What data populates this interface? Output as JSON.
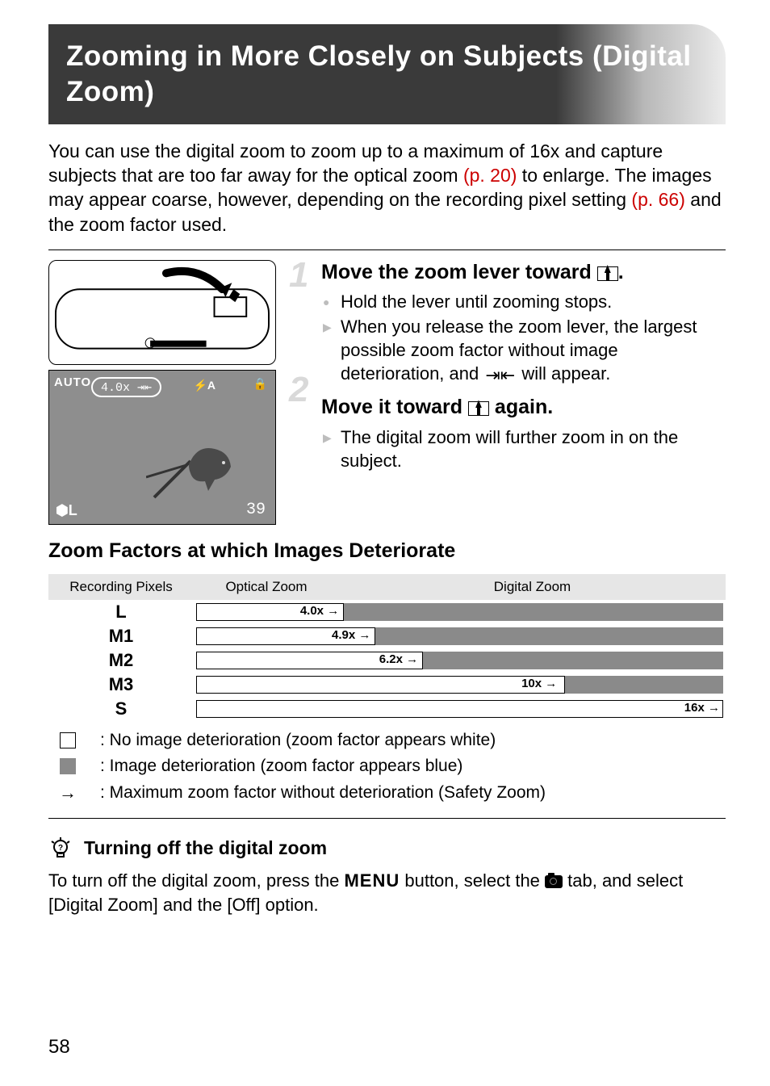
{
  "title": "Zooming in More Closely on Subjects (Digital Zoom)",
  "intro": {
    "part1": "You can use the digital zoom to zoom up to a maximum of 16x and capture subjects that are too far away for the optical zoom ",
    "ref1": "(p. 20)",
    "part2": " to enlarge. The images may appear coarse, however, depending on the recording pixel setting ",
    "ref2": "(p. 66)",
    "part3": " and the zoom factor used."
  },
  "steps": {
    "s1": {
      "num": "1",
      "heading_pre": "Move the zoom lever toward ",
      "heading_post": ".",
      "bullet1": "Hold the lever until zooming stops.",
      "bullet2_pre": "When you release the zoom lever, the largest possible zoom factor without image deterioration, and ",
      "bullet2_icon": "⇥⇤",
      "bullet2_post": " will appear."
    },
    "s2": {
      "num": "2",
      "heading_pre": "Move it toward ",
      "heading_post": " again.",
      "bullet1": "The digital zoom will further zoom in on the subject."
    }
  },
  "step_illus": {
    "lcd_zoom": "4.0x",
    "lcd_auto": "AUTO",
    "lcd_flash": "⚡A",
    "lcd_stab": "🔒",
    "lcd_size": "⬢L",
    "lcd_shots": "39"
  },
  "table_section_heading": "Zoom Factors at which Images Deteriorate",
  "table": {
    "headers": {
      "pix": "Recording Pixels",
      "opt": "Optical Zoom",
      "dig": "Digital Zoom"
    },
    "rows": [
      {
        "label": "L",
        "white_pct": 28,
        "factor": "4.0x →"
      },
      {
        "label": "M1",
        "white_pct": 34,
        "factor": "4.9x →"
      },
      {
        "label": "M2",
        "white_pct": 43,
        "factor": "6.2x →"
      },
      {
        "label": "M3",
        "white_pct": 70,
        "factor": "10x →"
      },
      {
        "label": "S",
        "white_pct": 100,
        "factor": "16x →"
      }
    ]
  },
  "legend": {
    "white": ": No image deterioration (zoom factor appears white)",
    "gray": ": Image deterioration (zoom factor appears blue)",
    "arrow": ": Maximum zoom factor without deterioration (Safety Zoom)",
    "arrow_sym": "→"
  },
  "tip": {
    "heading": "Turning off the digital zoom",
    "text_pre": "To turn off the digital zoom, press the ",
    "menu_word": "MENU",
    "text_mid": " button, select the ",
    "text_post": " tab, and select [Digital Zoom] and the [Off] option."
  },
  "page_number": "58",
  "chart_data": {
    "type": "bar",
    "title": "Zoom Factors at which Images Deteriorate",
    "xlabel": "Recording Pixels",
    "ylabel": "Max zoom factor without deterioration",
    "categories": [
      "L",
      "M1",
      "M2",
      "M3",
      "S"
    ],
    "values": [
      4.0,
      4.9,
      6.2,
      10,
      16
    ],
    "ylim": [
      0,
      16
    ],
    "annotations": {
      "optical_zoom_max": 4.0,
      "digital_zoom_max": 16
    }
  }
}
